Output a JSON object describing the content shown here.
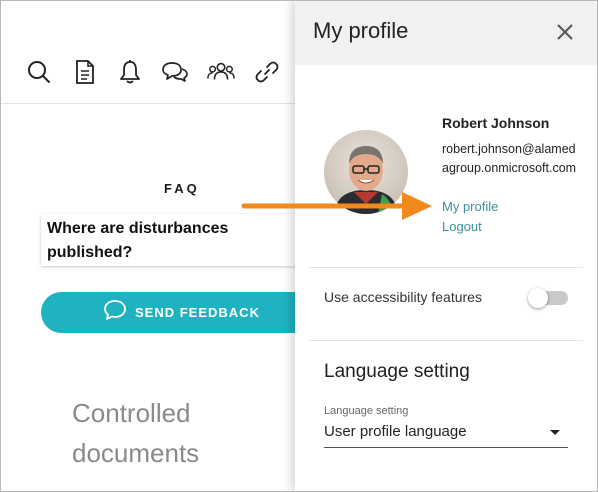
{
  "toolbar": {
    "icons": [
      "search-icon",
      "document-icon",
      "bell-icon",
      "chat-icon",
      "people-icon",
      "link-icon"
    ]
  },
  "faq": {
    "title": "FAQ",
    "question": "Where are disturbances published?"
  },
  "feedback": {
    "label": "SEND FEEDBACK"
  },
  "documents": {
    "heading": "Controlled documents"
  },
  "profile_panel": {
    "title": "My profile",
    "user": {
      "name": "Robert Johnson",
      "email": "robert.johnson@alamedagroup.onmicrosoft.com"
    },
    "links": {
      "profile": "My profile",
      "logout": "Logout"
    },
    "accessibility": {
      "label": "Use accessibility features",
      "enabled": false
    },
    "language": {
      "heading": "Language setting",
      "select_label": "Language setting",
      "selected": "User profile language"
    }
  },
  "colors": {
    "accent": "#1fb3c1",
    "link": "#3e8e9a",
    "annotation_arrow": "#f08a1c",
    "header_bg": "#f1f1f1"
  }
}
